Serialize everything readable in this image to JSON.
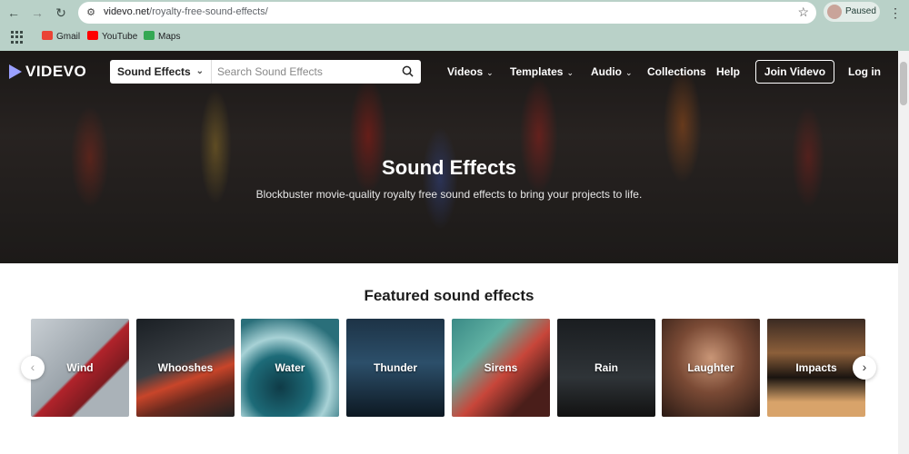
{
  "browser": {
    "url_host": "videvo.net",
    "url_path": "/royalty-free-sound-effects/",
    "profile_label": "Paused",
    "bookmarks": [
      {
        "label": "Gmail",
        "color": "#ea4335"
      },
      {
        "label": "YouTube",
        "color": "#ff0000"
      },
      {
        "label": "Maps",
        "color": "#34a853"
      }
    ]
  },
  "site": {
    "logo_text": "VIDEVO",
    "search": {
      "category": "Sound Effects",
      "placeholder": "Search Sound Effects"
    },
    "nav": {
      "videos": "Videos",
      "templates": "Templates",
      "audio": "Audio",
      "collections": "Collections",
      "help": "Help",
      "join": "Join Videvo",
      "login": "Log in"
    }
  },
  "hero": {
    "title": "Sound Effects",
    "subtitle": "Blockbuster movie-quality royalty free sound effects to bring your projects to life."
  },
  "featured": {
    "title": "Featured sound effects",
    "tiles": [
      {
        "label": "Wind",
        "bg": "linear-gradient(135deg,#c8ced3 0%,#9aa3aa 50%,#b1232b 52%,#7e1b20 70%,#aab2b8 72%)"
      },
      {
        "label": "Whooshes",
        "bg": "linear-gradient(160deg,#1a1f24 0%,#3a3f44 45%,#c8452a 60%,#6b2a1e 75%,#222 100%)"
      },
      {
        "label": "Water",
        "bg": "radial-gradient(circle at 40% 70%,#0f3b47 0%,#1d6b78 35%,#a8d2d6 55%,#2a6f7a 80%)"
      },
      {
        "label": "Thunder",
        "bg": "linear-gradient(180deg,#1d3346 0%,#2c4f6a 45%,#0d1822 100%)"
      },
      {
        "label": "Sirens",
        "bg": "linear-gradient(135deg,#3a8a86 0%,#5fb0a2 30%,#c8463a 55%,#4a1e1a 80%)"
      },
      {
        "label": "Rain",
        "bg": "linear-gradient(180deg,#1a1d20 0%,#2f3438 60%,#111 100%)"
      },
      {
        "label": "Laughter",
        "bg": "radial-gradient(circle at 50% 40%,#c99677 0%,#7a4a35 45%,#2a1a14 100%)"
      },
      {
        "label": "Impacts",
        "bg": "linear-gradient(180deg,#3b2a22 0%,#8c5f3a 35%,#1a1410 60%,#d8a36a 85%)"
      }
    ]
  }
}
